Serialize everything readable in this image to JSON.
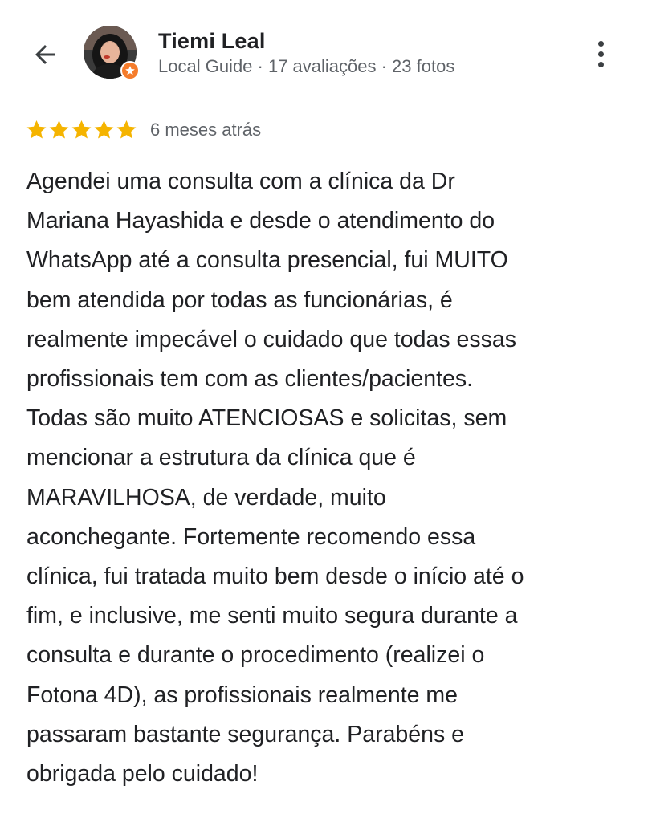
{
  "reviewer": {
    "name": "Tiemi Leal",
    "subtitle": "Local Guide · 17 avaliações · 23 fotos"
  },
  "review": {
    "rating": 5,
    "max_rating": 5,
    "time_ago": "6 meses atrás",
    "lines": [
      "Agendei uma consulta com a clínica da Dr",
      "Mariana Hayashida e desde o atendimento do",
      "WhatsApp até a consulta presencial, fui MUITO",
      "bem atendida por todas as funcionárias, é",
      "realmente impecável o cuidado que todas essas",
      "profissionais tem com as clientes/pacientes.",
      "Todas são muito ATENCIOSAS e solicitas, sem",
      "mencionar a estrutura da clínica que é",
      "MARAVILHOSA, de verdade, muito",
      "aconchegante. Fortemente recomendo essa",
      "clínica, fui tratada muito bem desde o início até o",
      "fim, e inclusive, me senti muito segura durante a",
      "consulta e durante o procedimento (realizei o",
      "Fotona 4D), as profissionais realmente me",
      "passaram bastante segurança. Parabéns e",
      "obrigada pelo cuidado!"
    ]
  },
  "icons": {
    "back": "arrow-left-icon",
    "more": "more-vertical-icon",
    "star": "star-icon",
    "badge": "local-guide-star-icon"
  },
  "colors": {
    "star": "#f5b400",
    "badge": "#f57c2b",
    "text": "#202124",
    "secondary": "#5f6368"
  }
}
